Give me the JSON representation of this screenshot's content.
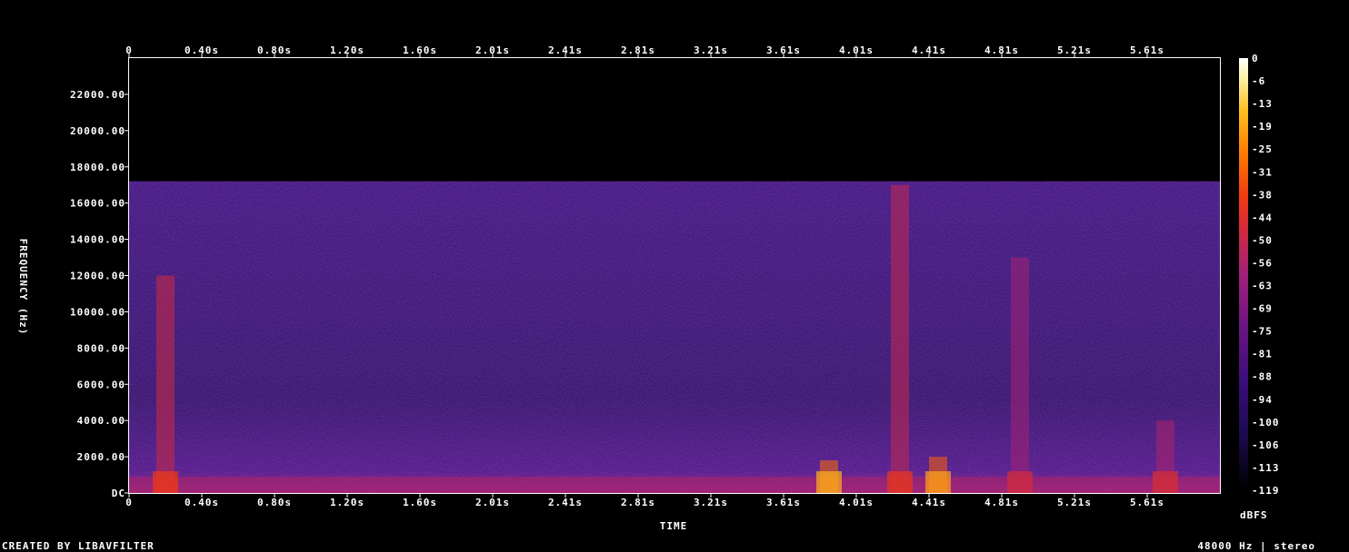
{
  "chart_data": {
    "type": "heatmap",
    "xlabel": "TIME",
    "ylabel": "FREQUENCY (Hz)",
    "colorbar_label": "dBFS",
    "x_ticks": [
      "0",
      "0.40s",
      "0.80s",
      "1.20s",
      "1.60s",
      "2.01s",
      "2.41s",
      "2.81s",
      "3.21s",
      "3.61s",
      "4.01s",
      "4.41s",
      "4.81s",
      "5.21s",
      "5.61s"
    ],
    "y_ticks": [
      "DC",
      "2000.00",
      "4000.00",
      "6000.00",
      "8000.00",
      "10000.00",
      "12000.00",
      "14000.00",
      "16000.00",
      "18000.00",
      "20000.00",
      "22000.00"
    ],
    "xlim": [
      0,
      6.0
    ],
    "ylim": [
      0,
      24000
    ],
    "colorbar_ticks": [
      "0",
      "-6",
      "-13",
      "-19",
      "-25",
      "-31",
      "-38",
      "-44",
      "-50",
      "-56",
      "-63",
      "-69",
      "-75",
      "-81",
      "-88",
      "-94",
      "-100",
      "-106",
      "-113",
      "-119"
    ],
    "colorbar_range": [
      -119,
      0
    ],
    "lowpass_cutoff_hz": 17200,
    "background_level_db": -92,
    "bursts": [
      {
        "t": 0.2,
        "f_max": 12000,
        "level": -60
      },
      {
        "t": 3.85,
        "f_max": 1800,
        "level": -38
      },
      {
        "t": 4.24,
        "f_max": 17000,
        "level": -62
      },
      {
        "t": 4.45,
        "f_max": 2000,
        "level": -40
      },
      {
        "t": 4.9,
        "f_max": 13000,
        "level": -70
      },
      {
        "t": 5.7,
        "f_max": 4000,
        "level": -68
      }
    ],
    "colormap": [
      "#000000",
      "#1a0a4a",
      "#3a0e7a",
      "#6a1580",
      "#a0207a",
      "#d02a40",
      "#f03a10",
      "#ff7a00",
      "#ffc020",
      "#fff0a0",
      "#ffffff"
    ]
  },
  "footer": {
    "left": "CREATED BY LIBAVFILTER",
    "right": "48000 Hz | stereo"
  }
}
